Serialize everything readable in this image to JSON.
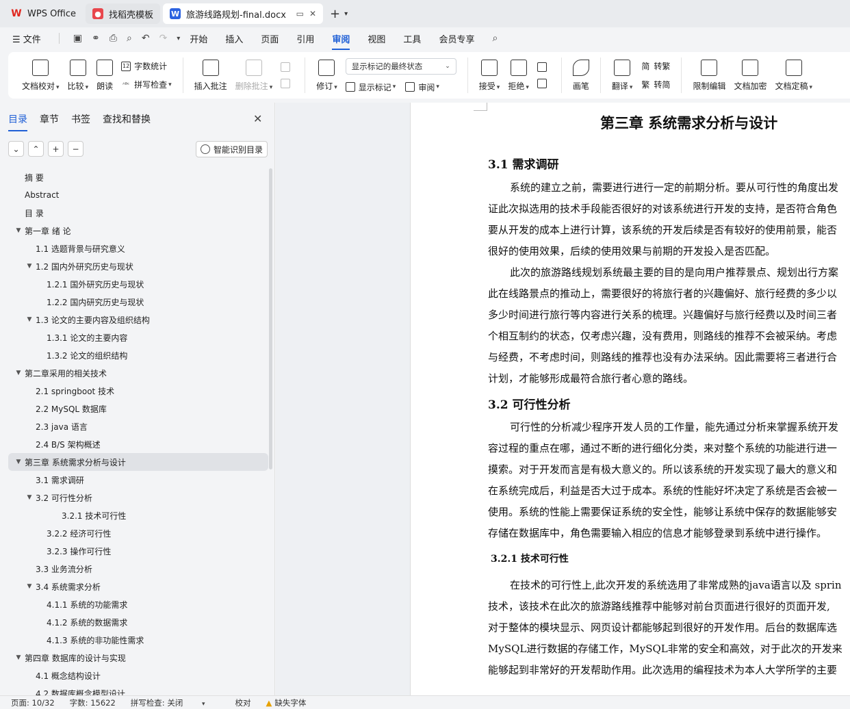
{
  "tabs": [
    {
      "label": "WPS Office",
      "icon": "wps-logo-icon",
      "color": "#e0271f"
    },
    {
      "label": "找稻壳模板",
      "icon": "docer-icon",
      "color": "#e8464c"
    },
    {
      "label": "旅游线路规划-final.docx",
      "icon": "word-doc-icon",
      "color": "#2b62e0"
    }
  ],
  "menu": {
    "file": "文件",
    "items": [
      "开始",
      "插入",
      "页面",
      "引用",
      "审阅",
      "视图",
      "工具",
      "会员专享"
    ],
    "active": "审阅"
  },
  "ribbon": {
    "doc_check": "文档校对",
    "compare": "比较",
    "read": "朗读",
    "word_count": "字数统计",
    "spell_check": "拼写检查",
    "insert_comment": "插入批注",
    "delete_comment": "删除批注",
    "track": "修订",
    "markup_state": "显示标记的最终状态",
    "show_markup": "显示标记",
    "review": "审阅",
    "accept": "接受",
    "reject": "拒绝",
    "pen": "画笔",
    "translate": "翻译",
    "to_traditional": "转繁",
    "to_simplified": "转简",
    "restrict_edit": "限制编辑",
    "encrypt": "文档加密",
    "finalize": "文档定稿"
  },
  "nav": {
    "tabs": [
      "目录",
      "章节",
      "书签",
      "查找和替换"
    ],
    "active_tab": "目录",
    "smart_toc": "智能识别目录",
    "toc": [
      {
        "label": "摘  要",
        "level": 1,
        "arrow": false
      },
      {
        "label": "Abstract",
        "level": 1,
        "arrow": false
      },
      {
        "label": "目  录",
        "level": 1,
        "arrow": false
      },
      {
        "label": "第一章  绪  论",
        "level": 1,
        "arrow": true
      },
      {
        "label": "1.1 选题背景与研究意义",
        "level": 2,
        "arrow": false
      },
      {
        "label": "1.2 国内外研究历史与现状",
        "level": 2,
        "arrow": true
      },
      {
        "label": "1.2.1 国外研究历史与现状",
        "level": 3,
        "arrow": false
      },
      {
        "label": "1.2.2 国内研究历史与现状",
        "level": 3,
        "arrow": false
      },
      {
        "label": "1.3 论文的主要内容及组织结构",
        "level": 2,
        "arrow": true
      },
      {
        "label": "1.3.1 论文的主要内容",
        "level": 3,
        "arrow": false
      },
      {
        "label": "1.3.2 论文的组织结构",
        "level": 3,
        "arrow": false
      },
      {
        "label": "第二章采用的相关技术",
        "level": 1,
        "arrow": true
      },
      {
        "label": "2.1 springboot 技术",
        "level": 2,
        "arrow": false
      },
      {
        "label": "2.2 MySQL 数据库",
        "level": 2,
        "arrow": false
      },
      {
        "label": "2.3 java 语言",
        "level": 2,
        "arrow": false
      },
      {
        "label": "2.4 B/S 架构概述",
        "level": 2,
        "arrow": false
      },
      {
        "label": "第三章  系统需求分析与设计",
        "level": 1,
        "arrow": true,
        "active": true
      },
      {
        "label": "3.1 需求调研",
        "level": 2,
        "arrow": false
      },
      {
        "label": "3.2 可行性分析",
        "level": 2,
        "arrow": true
      },
      {
        "label": "3.2.1   技术可行性",
        "level": 4,
        "arrow": false
      },
      {
        "label": "3.2.2 经济可行性",
        "level": 3,
        "arrow": false
      },
      {
        "label": "3.2.3 操作可行性",
        "level": 3,
        "arrow": false
      },
      {
        "label": "3.3 业务流分析",
        "level": 2,
        "arrow": false
      },
      {
        "label": "3.4 系统需求分析",
        "level": 2,
        "arrow": true
      },
      {
        "label": "4.1.1 系统的功能需求",
        "level": 3,
        "arrow": false
      },
      {
        "label": "4.1.2 系统的数据需求",
        "level": 3,
        "arrow": false
      },
      {
        "label": "4.1.3 系统的非功能性需求",
        "level": 3,
        "arrow": false
      },
      {
        "label": "第四章  数据库的设计与实现",
        "level": 1,
        "arrow": true
      },
      {
        "label": "4.1 概念结构设计",
        "level": 2,
        "arrow": false
      },
      {
        "label": "4.2 数据库概念模型设计",
        "level": 2,
        "arrow": false
      }
    ]
  },
  "document": {
    "title": "第三章 系统需求分析与设计",
    "h_3_1": "3.1 需求调研",
    "p1": [
      "系统的建立之前，需要进行进行一定的前期分析。要从可行性的角度出发",
      "证此次拟选用的技术手段能否很好的对该系统进行开发的支持，是否符合角色",
      "要从开发的成本上进行计算，该系统的开发后续是否有较好的使用前景，能否",
      "很好的使用效果，后续的使用效果与前期的开发投入是否匹配。"
    ],
    "p2": [
      "此次的旅游路线规划系统最主要的目的是向用户推荐景点、规划出行方案",
      "此在线路景点的推动上，需要很好的将旅行者的兴趣偏好、旅行经费的多少以",
      "多少时间进行旅行等内容进行关系的梳理。兴趣偏好与旅行经费以及时间三者",
      "个相互制约的状态，仅考虑兴趣，没有费用，则路线的推荐不会被采纳。考虑",
      "与经费，不考虑时间，则路线的推荐也没有办法采纳。因此需要将三者进行合",
      "计划，才能够形成最符合旅行者心意的路线。"
    ],
    "h_3_2": "3.2 可行性分析",
    "p3": [
      "可行性的分析减少程序开发人员的工作量，能先通过分析来掌握系统开发",
      "容过程的重点在哪，通过不断的进行细化分类，来对整个系统的功能进行进一",
      "摸索。对于开发而言是有极大意义的。所以该系统的开发实现了最大的意义和",
      "在系统完成后，利益是否大过于成本。系统的性能好坏决定了系统是否会被一",
      "使用。系统的性能上需要保证系统的安全性，能够让系统中保存的数据能够安",
      "存储在数据库中，角色需要输入相应的信息才能够登录到系统中进行操作。"
    ],
    "h_3_2_1": "3.2.1  技术可行性",
    "p4": [
      "在技术的可行性上,此次开发的系统选用了非常成熟的java语言以及 sprin",
      "技术，该技术在此次的旅游路线推荐中能够对前台页面进行很好的页面开发,",
      "对于整体的模块显示、网页设计都能够起到很好的开发作用。后台的数据库选",
      "MySQL进行数据的存储工作，MySQL非常的安全和高效，对于此次的开发来",
      "能够起到非常好的开发帮助作用。此次选用的编程技术为本人大学所学的主要"
    ]
  },
  "status": {
    "page": "页面: 10/32",
    "words": "字数: 15622",
    "spell": "拼写检查: 关闭",
    "proof": "校对",
    "missing_font": "缺失字体"
  },
  "colors": {
    "accent": "#1f5fd6",
    "warning": "#e6a100"
  }
}
